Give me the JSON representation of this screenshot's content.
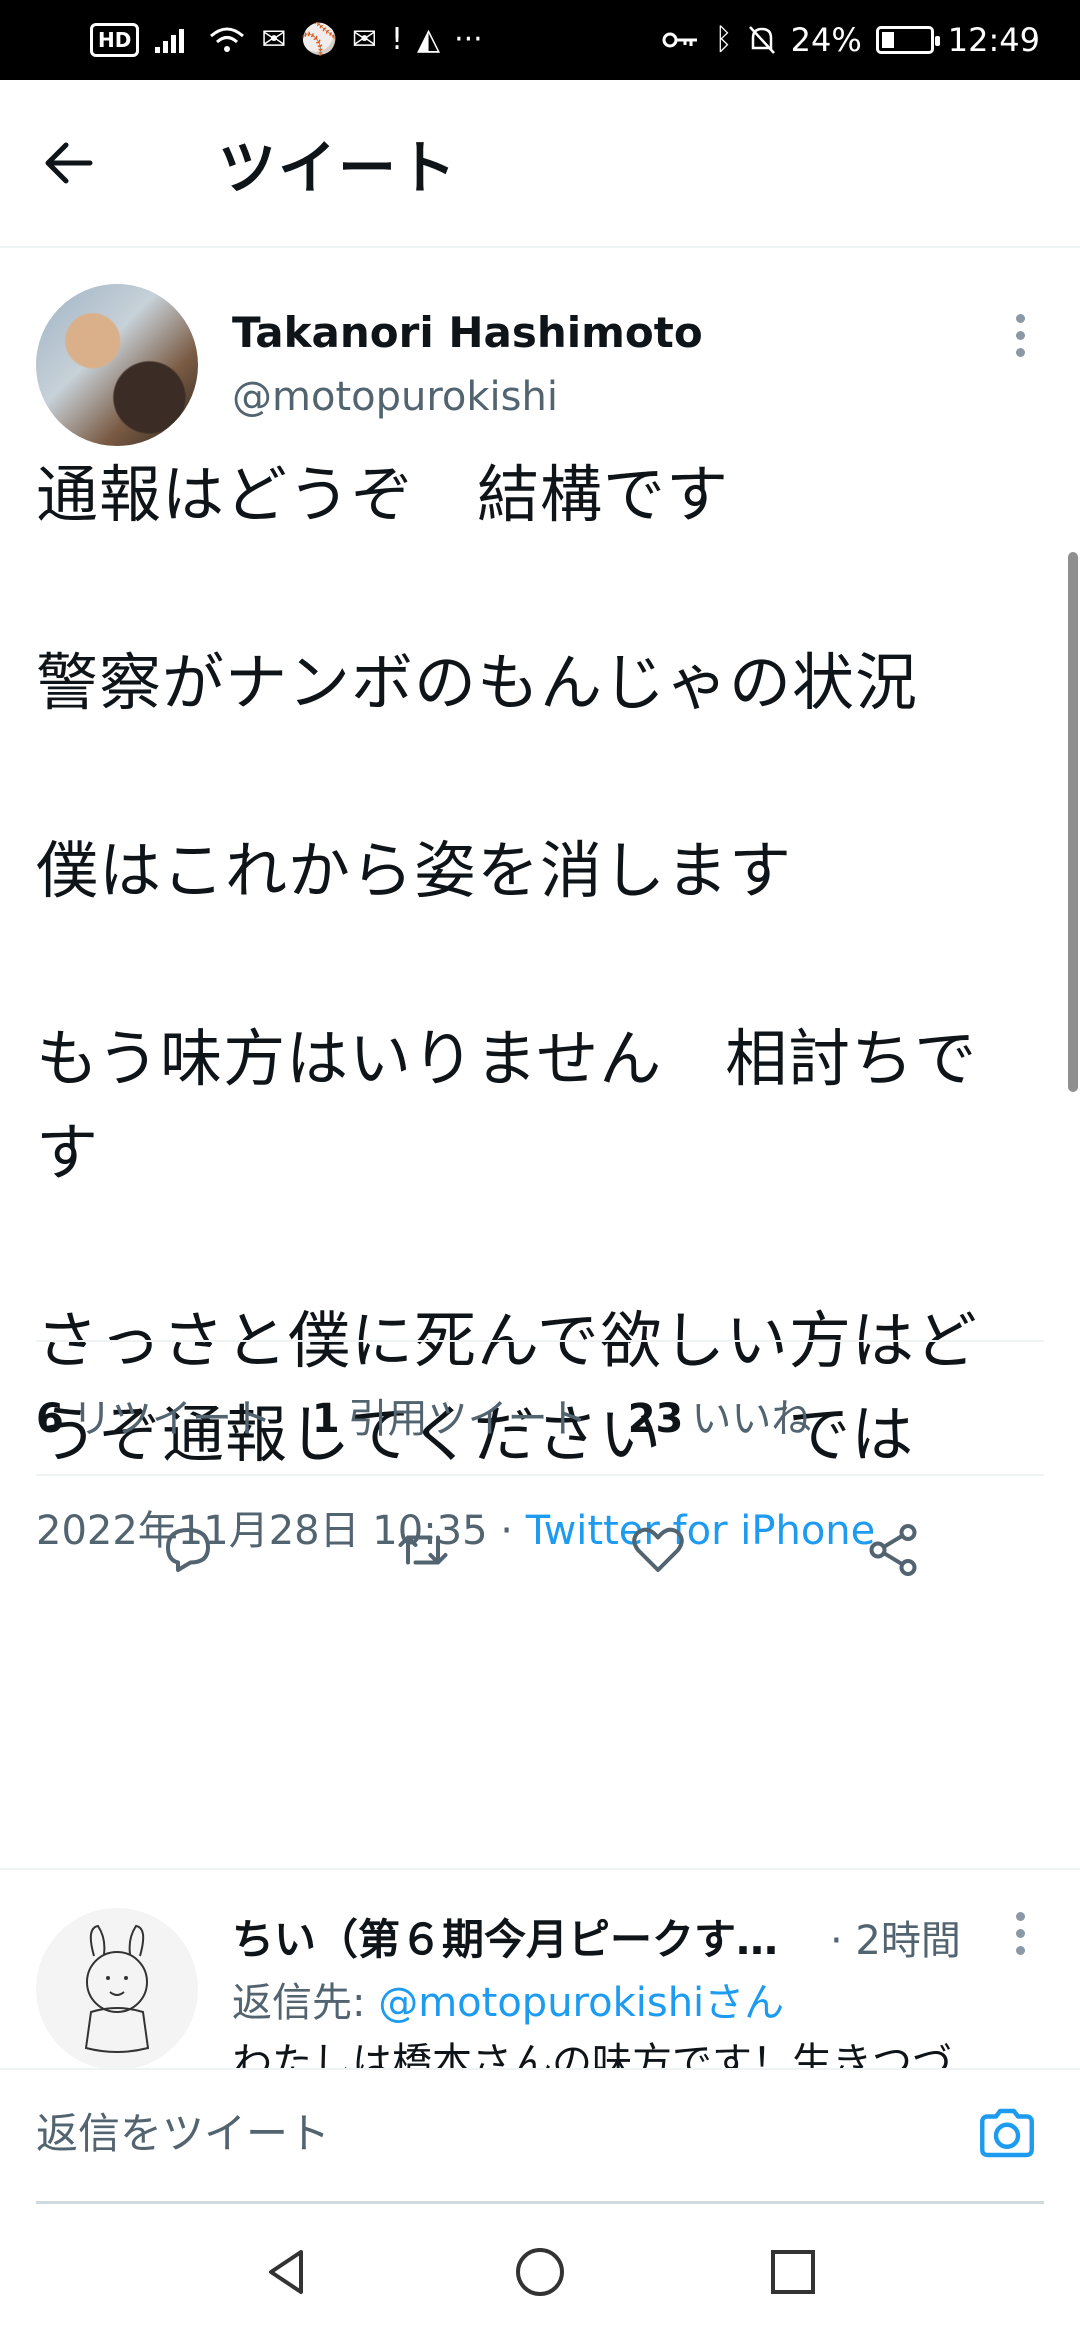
{
  "status_bar": {
    "hd": "HD",
    "battery_percent": "24%",
    "battery_level": 0.24,
    "time": "12:49",
    "more": "···"
  },
  "header": {
    "title": "ツイート"
  },
  "tweet": {
    "author_name": "Takanori Hashimoto",
    "author_handle": "@motopurokishi",
    "body": "通報はどうぞ　結構です\n\n警察がナンボのもんじゃの状況\n\n僕はこれから姿を消します\n\nもう味方はいりません　相討ちで\nす\n\nさっさと僕に死んで欲しい方はど\nうぞ通報してください　　では",
    "timestamp": "2022年11月28日 10:35",
    "separator": " · ",
    "source": "Twitter for iPhone",
    "stats": {
      "retweets_count": "6",
      "retweets_label": "リツイート",
      "quotes_count": "1",
      "quotes_label": "引用ツイート",
      "likes_count": "23",
      "likes_label": "いいね"
    }
  },
  "reply": {
    "author_name": "ちい（第６期今月ピークす…",
    "time": "· 2時間",
    "reply_to_label": "返信先: ",
    "reply_to_handle": "@motopurokishi",
    "reply_to_suffix": "さん",
    "text": "わたしは橋本さんの味方です！生きつづ"
  },
  "compose": {
    "placeholder": "返信をツイート"
  },
  "colors": {
    "accent": "#1d9bf0",
    "text": "#0f1419",
    "secondary": "#536471"
  }
}
